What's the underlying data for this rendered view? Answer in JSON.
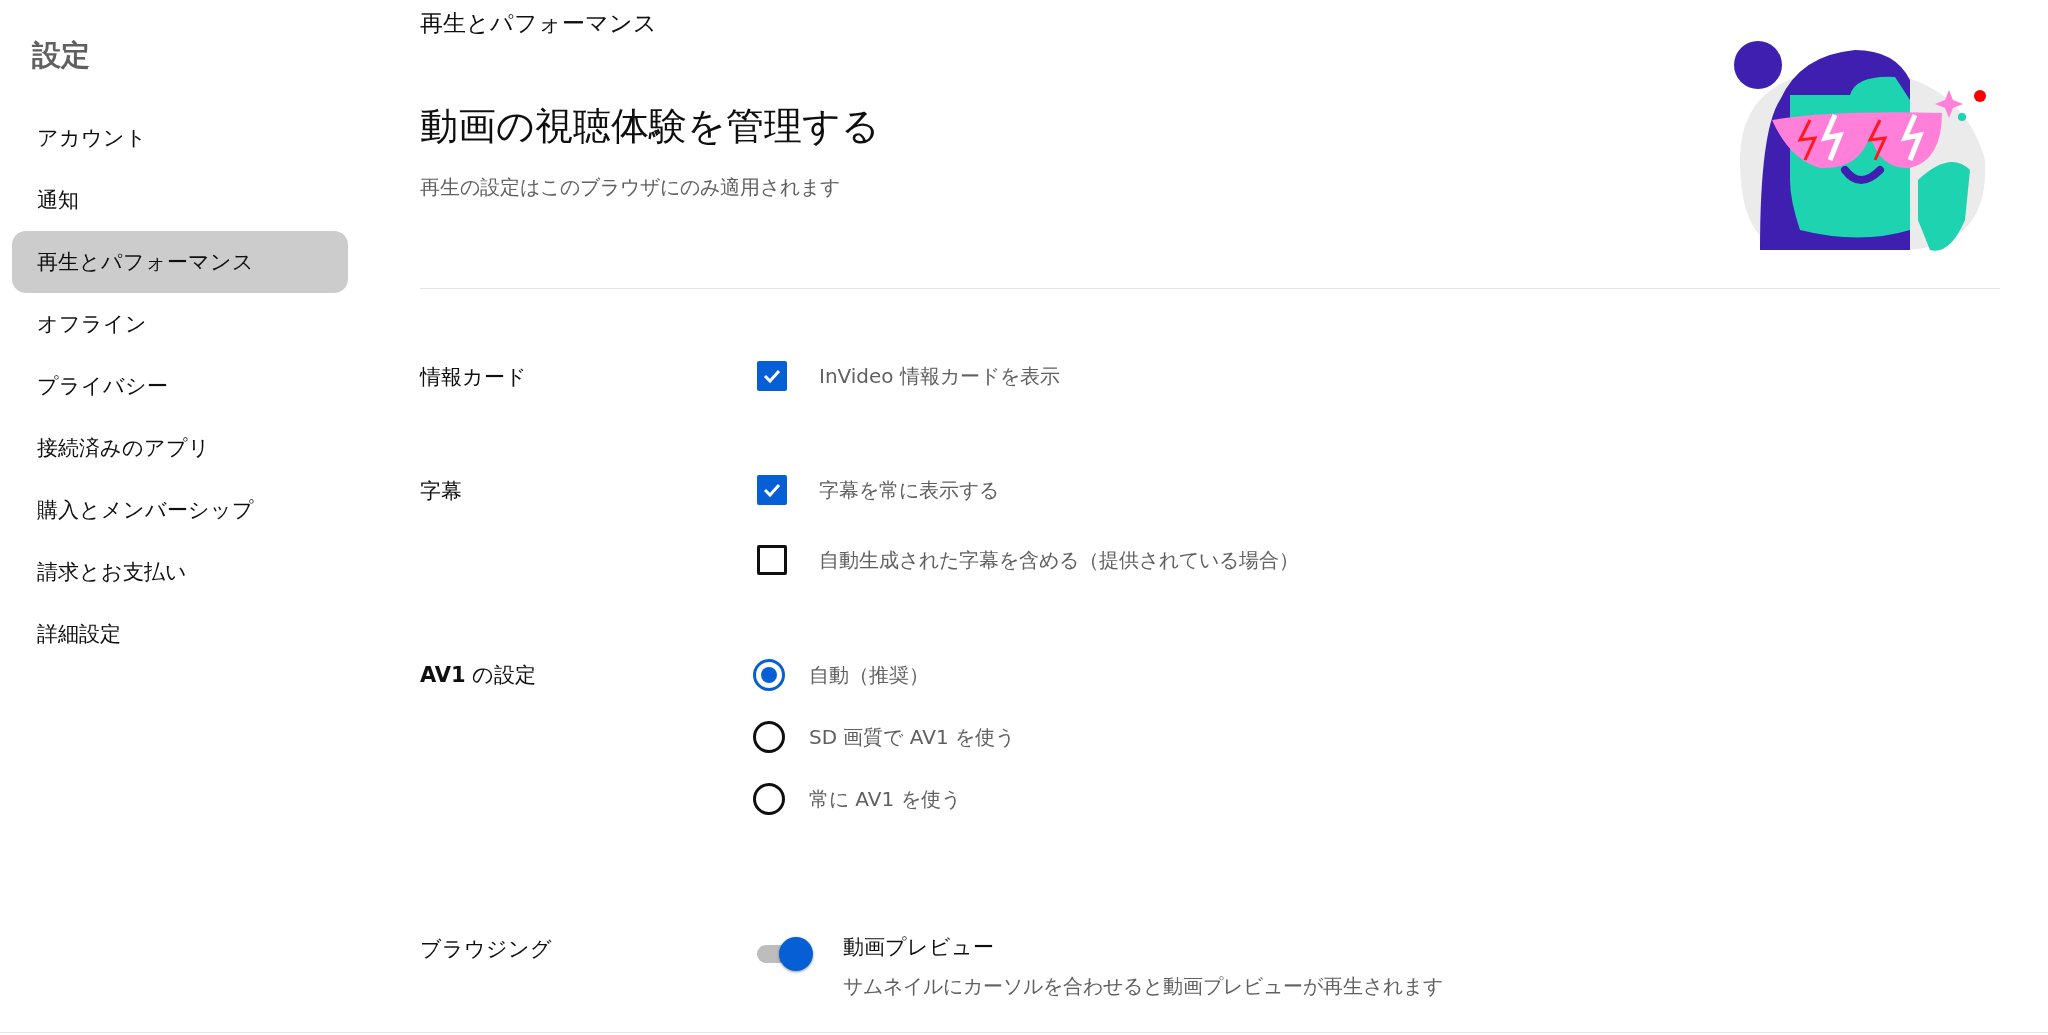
{
  "sidebar": {
    "title": "設定",
    "items": [
      {
        "label": "アカウント",
        "selected": false
      },
      {
        "label": "通知",
        "selected": false
      },
      {
        "label": "再生とパフォーマンス",
        "selected": true
      },
      {
        "label": "オフライン",
        "selected": false
      },
      {
        "label": "プライバシー",
        "selected": false
      },
      {
        "label": "接続済みのアプリ",
        "selected": false
      },
      {
        "label": "購入とメンバーシップ",
        "selected": false
      },
      {
        "label": "請求とお支払い",
        "selected": false
      },
      {
        "label": "詳細設定",
        "selected": false
      }
    ]
  },
  "header": {
    "breadcrumb": "再生とパフォーマンス",
    "title": "動画の視聴体験を管理する",
    "subtitle": "再生の設定はこのブラウザにのみ適用されます"
  },
  "sections": [
    {
      "label": "情報カード",
      "options": [
        {
          "kind": "checkbox",
          "label": "InVideo 情報カードを表示",
          "checked": true
        }
      ]
    },
    {
      "label": "字幕",
      "options": [
        {
          "kind": "checkbox",
          "label": "字幕を常に表示する",
          "checked": true
        },
        {
          "kind": "checkbox",
          "label": "自動生成された字幕を含める（提供されている場合）",
          "checked": false
        }
      ]
    },
    {
      "label": "**AV1** の設定",
      "options": [
        {
          "kind": "radio",
          "label": "自動（推奨）",
          "selected": true
        },
        {
          "kind": "radio",
          "label": "SD 画質で AV1 を使う",
          "selected": false
        },
        {
          "kind": "radio",
          "label": "常に AV1 を使う",
          "selected": false
        }
      ]
    },
    {
      "label": "ブラウジング",
      "options": [
        {
          "kind": "toggle",
          "label": "動画プレビュー",
          "description": "サムネイルにカーソルを合わせると動画プレビューが再生されます",
          "on": true
        }
      ]
    }
  ]
}
